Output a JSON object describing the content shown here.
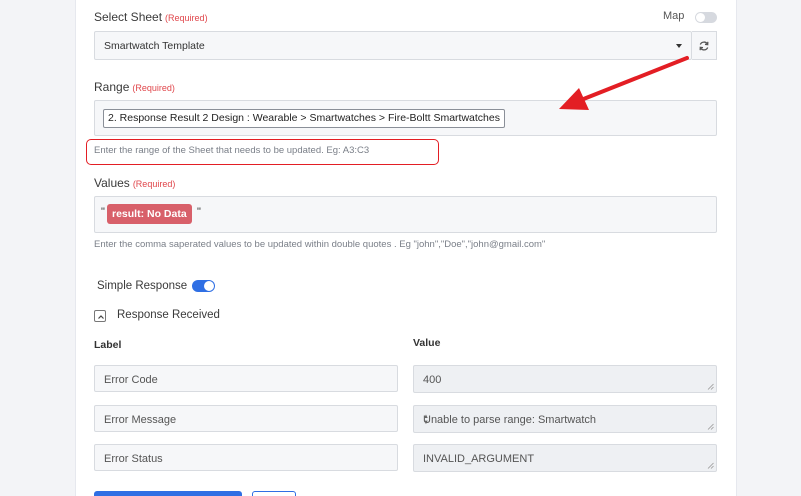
{
  "sheet": {
    "label": "Select Sheet",
    "required": "(Required)",
    "map_label": "Map",
    "selected": "Smartwatch Template"
  },
  "range": {
    "label": "Range",
    "required": "(Required)",
    "value": "2. Response Result 2 Design : Wearable > Smartwatches > Fire-Boltt Smartwatches",
    "hint": "Enter the range of the Sheet that needs to be updated. Eg: A3:C3"
  },
  "values": {
    "label": "Values",
    "required": "(Required)",
    "open_quote": "\"",
    "chip": "result: No Data",
    "close_quote": "\"",
    "hint": "Enter the comma saperated values to be updated within double quotes . Eg \"john\",\"Doe\",\"john@gmail.com\""
  },
  "simple_response": {
    "label": "Simple Response",
    "enabled": true
  },
  "response_received": {
    "label": "Response Received",
    "col_label": "Label",
    "col_value": "Value",
    "rows": [
      {
        "label": "Error Code",
        "value": "400"
      },
      {
        "label": "Error Message",
        "value": "Unable to parse range: Smartwatch"
      },
      {
        "label": "Error Status",
        "value": "INVALID_ARGUMENT"
      }
    ]
  },
  "colors": {
    "accent": "#2f6fe4",
    "required": "#e0474c",
    "annotation": "#e31e24",
    "chip": "#d8606a"
  },
  "icons": {
    "refresh": "refresh-icon",
    "dropdown": "caret-down-icon",
    "collapse": "chevron-up-icon",
    "annotation_arrow": "red-arrow-icon"
  }
}
